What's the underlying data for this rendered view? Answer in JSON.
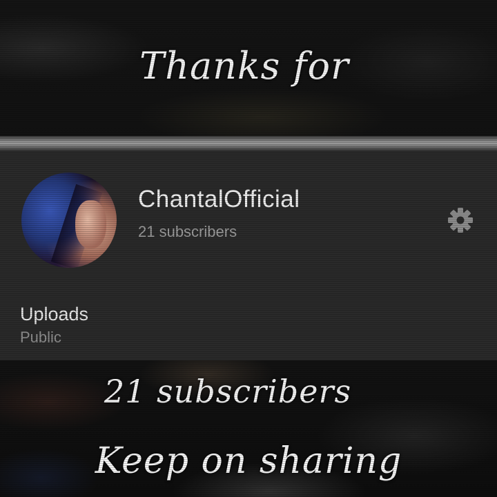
{
  "captions": {
    "top": "Thanks for",
    "middle": "21 subscribers",
    "bottom": "Keep on sharing"
  },
  "channel": {
    "name": "ChantalOfficial",
    "subscribers": "21 subscribers",
    "settings_icon": "gear-icon"
  },
  "uploads": {
    "title": "Uploads",
    "visibility": "Public"
  },
  "colors": {
    "panel_bg": "#2a2a2a",
    "name_text": "#eeeeee",
    "secondary_text": "#9c9c9c",
    "gear_icon": "#8c8c8c"
  }
}
